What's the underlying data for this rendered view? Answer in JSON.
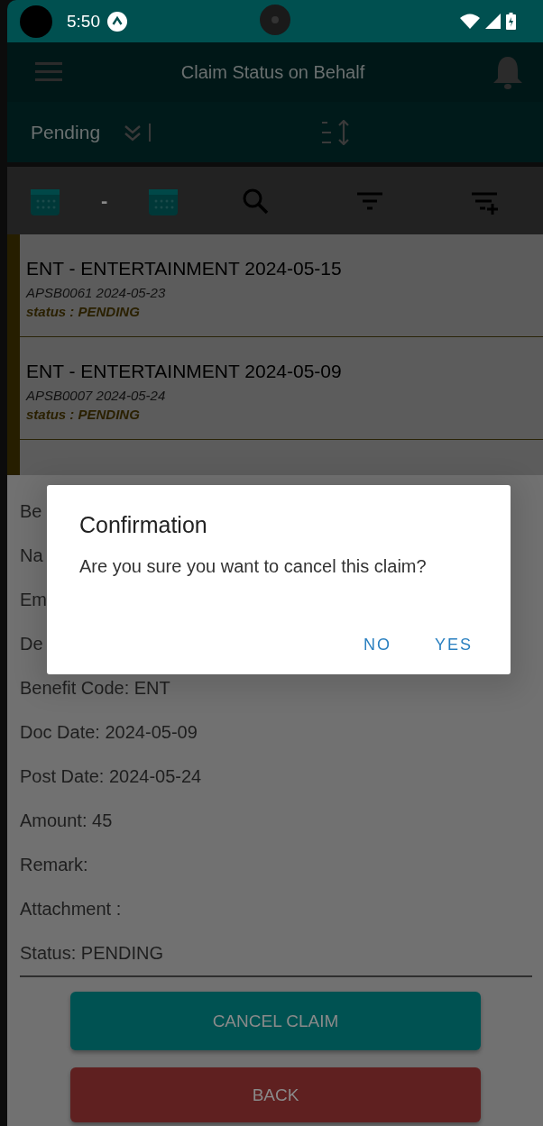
{
  "status_bar": {
    "time": "5:50"
  },
  "app_bar": {
    "title": "Claim Status on Behalf"
  },
  "filter_bar": {
    "status": "Pending"
  },
  "toolbar": {
    "date_separator": "-"
  },
  "claims": [
    {
      "title": "ENT - ENTERTAINMENT 2024-05-15",
      "subtitle": "APSB0061 2024-05-23",
      "status": "status : PENDING"
    },
    {
      "title": "ENT - ENTERTAINMENT 2024-05-09",
      "subtitle": "APSB0007 2024-05-24",
      "status": "status : PENDING"
    }
  ],
  "details": [
    "Be",
    "Na",
    "Em",
    "De",
    "Benefit Code: ENT",
    "Doc Date: 2024-05-09",
    "Post Date: 2024-05-24",
    "Amount: 45",
    "Remark:",
    "Attachment :",
    "Status: PENDING"
  ],
  "actions": [
    {
      "label": "CANCEL CLAIM",
      "kind": "primary"
    },
    {
      "label": "BACK",
      "kind": "danger"
    }
  ],
  "dialog": {
    "title": "Confirmation",
    "message": "Are you sure you want to cancel this claim?",
    "buttons": [
      "NO",
      "YES"
    ]
  }
}
